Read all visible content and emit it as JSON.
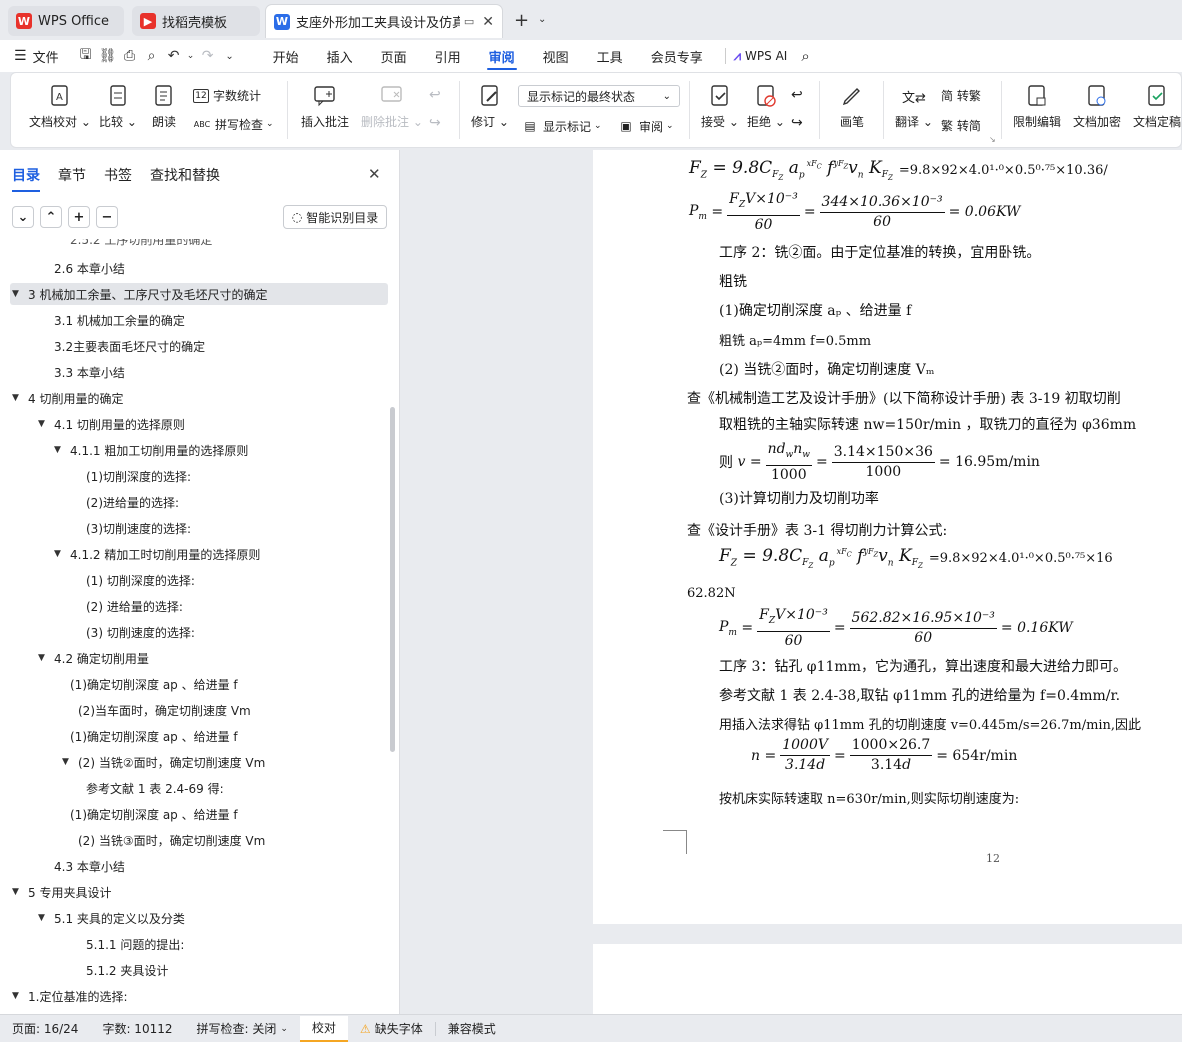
{
  "tabs": [
    {
      "label": "WPS Office",
      "icon": "wps-logo-icon"
    },
    {
      "label": "找稻壳模板",
      "icon": "docer-logo-icon"
    },
    {
      "label": "支座外形加工夹具设计及仿真",
      "icon": "word-doc-icon"
    }
  ],
  "file_menu": "文件",
  "menu": [
    "开始",
    "插入",
    "页面",
    "引用",
    "审阅",
    "视图",
    "工具",
    "会员专享"
  ],
  "active_menu": "审阅",
  "wps_ai": "WPS AI",
  "ribbon": {
    "proofread": "文档校对",
    "compare": "比较",
    "read_aloud": "朗读",
    "word_count": "字数统计",
    "spell_check": "拼写检查",
    "insert_comment": "插入批注",
    "delete_comment": "删除批注",
    "revise": "修订",
    "show_markup_state": "显示标记的最终状态",
    "show_markup": "显示标记",
    "review_pane": "审阅",
    "accept": "接受",
    "reject": "拒绝",
    "pen": "画笔",
    "translate": "翻译",
    "trad_simp": "简 转繁",
    "simp_trad": "繁 转简",
    "restrict_edit": "限制编辑",
    "encrypt": "文档加密",
    "finalize": "文档定稿"
  },
  "panel": {
    "tabs": [
      "目录",
      "章节",
      "书签",
      "查找和替换"
    ],
    "smart_toc": "智能识别目录"
  },
  "toc": [
    {
      "text": "2.6   本章小结",
      "level": 2,
      "caret": ""
    },
    {
      "text": "3   机械加工余量、工序尺寸及毛坯尺寸的确定",
      "level": 1,
      "caret": "down",
      "hl": true
    },
    {
      "text": "3.1   机械加工余量的确定",
      "level": 2,
      "caret": ""
    },
    {
      "text": "3.2主要表面毛坯尺寸的确定",
      "level": 2,
      "caret": ""
    },
    {
      "text": "3.3   本章小结",
      "level": 2,
      "caret": ""
    },
    {
      "text": "4   切削用量的确定",
      "level": 1,
      "caret": "down"
    },
    {
      "text": "4.1   切削用量的选择原则",
      "level": 2,
      "caret": "down"
    },
    {
      "text": "4.1.1   粗加工切削用量的选择原则",
      "level": 3,
      "caret": "down"
    },
    {
      "text": "(1)切削深度的选择:",
      "level": 4,
      "caret": ""
    },
    {
      "text": "(2)进给量的选择:",
      "level": 4,
      "caret": ""
    },
    {
      "text": "(3)切削速度的选择:",
      "level": 4,
      "caret": ""
    },
    {
      "text": "4.1.2   精加工时切削用量的选择原则",
      "level": 3,
      "caret": "down"
    },
    {
      "text": "(1)  切削深度的选择:",
      "level": 4,
      "caret": ""
    },
    {
      "text": "(2)  进给量的选择:",
      "level": 4,
      "caret": ""
    },
    {
      "text": "(3)  切削速度的选择:",
      "level": 4,
      "caret": ""
    },
    {
      "text": "4.2   确定切削用量",
      "level": 2,
      "caret": "down"
    },
    {
      "text": "(1)确定切削深度 ap 、给进量 f",
      "level": 3,
      "caret": ""
    },
    {
      "text": "(2)当车面时，确定切削速度 Vm",
      "level": 3.5,
      "caret": ""
    },
    {
      "text": "(1)确定切削深度 ap 、给进量 f",
      "level": 3,
      "caret": ""
    },
    {
      "text": "(2)  当铣②面时，确定切削速度 Vm",
      "level": 3.5,
      "caret": "down"
    },
    {
      "text": "参考文献 1 表 2.4-69 得:",
      "level": 4,
      "caret": ""
    },
    {
      "text": "(1)确定切削深度 ap 、给进量 f",
      "level": 3,
      "caret": ""
    },
    {
      "text": "(2)  当铣③面时，确定切削速度 Vm",
      "level": 3.5,
      "caret": ""
    },
    {
      "text": "4.3   本章小结",
      "level": 2,
      "caret": ""
    },
    {
      "text": "5   专用夹具设计",
      "level": 1,
      "caret": "down"
    },
    {
      "text": "5.1  夹具的定义以及分类",
      "level": 2,
      "caret": "down"
    },
    {
      "text": "5.1.1  问题的提出:",
      "level": 4,
      "caret": ""
    },
    {
      "text": "5.1.2    夹具设计",
      "level": 4,
      "caret": ""
    },
    {
      "text": "1.定位基准的选择:",
      "level": 1,
      "caret": "down"
    }
  ],
  "doc": {
    "eq1_tail": "=9.8×92×4.0¹·⁰×0.5⁰·⁷⁵×10.36/",
    "pm1_num": "344×10.36×10⁻³",
    "pm1_result": "= 0.06KW",
    "l1": "工序 2：铣②面。由于定位基准的转换，宜用卧铣。",
    "l2": "粗铣",
    "l3": "(1)确定切削深度 aₚ 、给进量 f",
    "l4": "粗铣    aₚ=4mm      f=0.5mm",
    "l5": "(2) 当铣②面时，确定切削速度 Vₘ",
    "l6": "查《机械制造工艺及设计手册》(以下简称设计手册) 表 3-19 初取切削",
    "l7": "取粗铣的主轴实际转速 nw=150r/min ，取铣刀的直径为 φ36mm",
    "v_num": "3.14×150×36",
    "v_result": "= 16.95m/min",
    "l8": "(3)计算切削力及切削功率",
    "l9": "查《设计手册》表 3-1 得切削力计算公式:",
    "eq2_tail": "=9.8×92×4.0¹·⁰×0.5⁰·⁷⁵×16",
    "l10": "62.82N",
    "pm2_num": "562.82×16.95×10⁻³",
    "pm2_result": "= 0.16KW",
    "l11": "工序 3：钻孔 φ11mm，它为通孔，算出速度和最大进给力即可。",
    "l12": "参考文献 1 表 2.4-38,取钻 φ11mm 孔的进给量为 f=0.4mm/r.",
    "l13": "用插入法求得钻 φ11mm 孔的切削速度 v=0.445m/s=26.7m/min,因此",
    "n_num": "1000×26.7",
    "n_result": "= 654r/min",
    "l14": "按机床实际转速取 n=630r/min,则实际切削速度为:",
    "page_number": "12"
  },
  "status": {
    "page": "页面: 16/24",
    "words": "字数: 10112",
    "spell": "拼写检查: 关闭",
    "proof": "校对",
    "missing_font": "缺失字体",
    "compat": "兼容模式"
  },
  "colors": {
    "accent": "#1e5fe0",
    "warning": "#f5a623"
  }
}
